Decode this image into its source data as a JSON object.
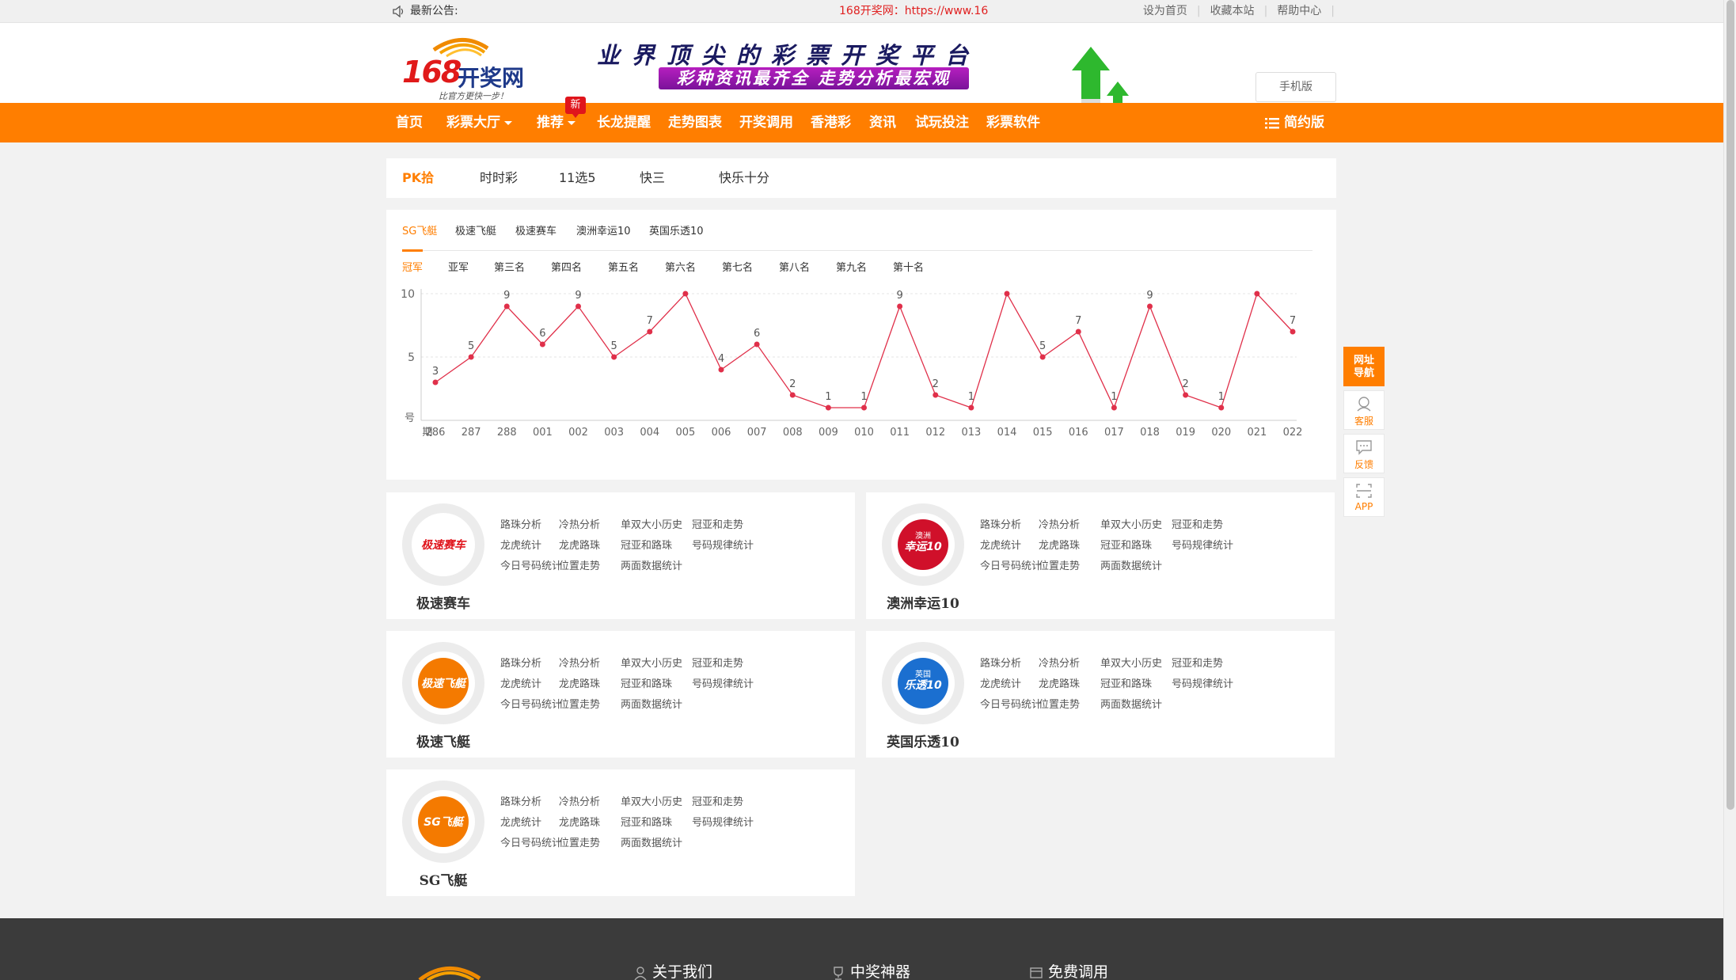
{
  "topbar": {
    "notice_label": "最新公告:",
    "notice_text": "168开奖网：https://www.16",
    "links": [
      "设为首页",
      "收藏本站",
      "帮助中心"
    ]
  },
  "header": {
    "logo_number": "168",
    "logo_text": "开奖网",
    "logo_tagline": "比官方更快一步！",
    "slogan_main": "业界顶尖的彩票开奖平台",
    "slogan_sub": "彩种资讯最齐全 走势分析最宏观",
    "mobile_button": "手机版"
  },
  "nav": {
    "items": [
      "首页",
      "彩票大厅",
      "推荐",
      "长龙提醒",
      "走势图表",
      "开奖调用",
      "香港彩",
      "资讯",
      "试玩投注",
      "彩票软件"
    ],
    "new_badge": "新",
    "simple_version": "简约版"
  },
  "category_tabs": [
    "PK拾",
    "时时彩",
    "11选5",
    "快三",
    "快乐十分"
  ],
  "sub_tabs": [
    "SG飞艇",
    "极速飞艇",
    "极速赛车",
    "澳洲幸运10",
    "英国乐透10"
  ],
  "rank_tabs": [
    "冠军",
    "亚军",
    "第三名",
    "第四名",
    "第五名",
    "第六名",
    "第七名",
    "第八名",
    "第九名",
    "第十名"
  ],
  "chart_data": {
    "type": "line",
    "x": [
      "286",
      "287",
      "288",
      "001",
      "002",
      "003",
      "004",
      "005",
      "006",
      "007",
      "008",
      "009",
      "010",
      "011",
      "012",
      "013",
      "014",
      "015",
      "016",
      "017",
      "018",
      "019",
      "020",
      "021",
      "022"
    ],
    "values": [
      3,
      5,
      9,
      6,
      9,
      5,
      7,
      10,
      4,
      6,
      2,
      1,
      1,
      9,
      2,
      1,
      10,
      5,
      7,
      1,
      9,
      2,
      1,
      10,
      7
    ],
    "y_ticks": [
      "10",
      "5"
    ],
    "ylabel": "号",
    "xlabel": "期",
    "ylim": [
      0,
      10
    ],
    "color": "#e0304a"
  },
  "card_links": [
    [
      "路珠分析",
      "冷热分析",
      "单双大小历史",
      "冠亚和走势"
    ],
    [
      "龙虎统计",
      "龙虎路珠",
      "冠亚和路珠",
      "号码规律统计"
    ],
    [
      "今日号码统计",
      "位置走势",
      "两面数据统计"
    ]
  ],
  "cards": [
    {
      "name": "极速赛车",
      "logo_text": "极速赛车"
    },
    {
      "name": "澳洲幸运10",
      "logo_text": "幸运10",
      "logo_small": "澳洲"
    },
    {
      "name": "极速飞艇",
      "logo_text": "极速飞艇"
    },
    {
      "name": "英国乐透10",
      "logo_text": "乐透10",
      "logo_small": "英国"
    },
    {
      "name": "SG飞艇",
      "logo_text": "SG飞艇"
    }
  ],
  "float_bar": {
    "nav_label_line1": "网址",
    "nav_label_line2": "导航",
    "service": "客服",
    "feedback": "反馈",
    "app": "APP"
  },
  "footer": {
    "links": [
      "关于我们",
      "中奖神器",
      "免费调用"
    ]
  },
  "colors": {
    "brand_orange": "#ff7e00",
    "notice_red": "#e02020",
    "chart_line": "#e0304a"
  }
}
